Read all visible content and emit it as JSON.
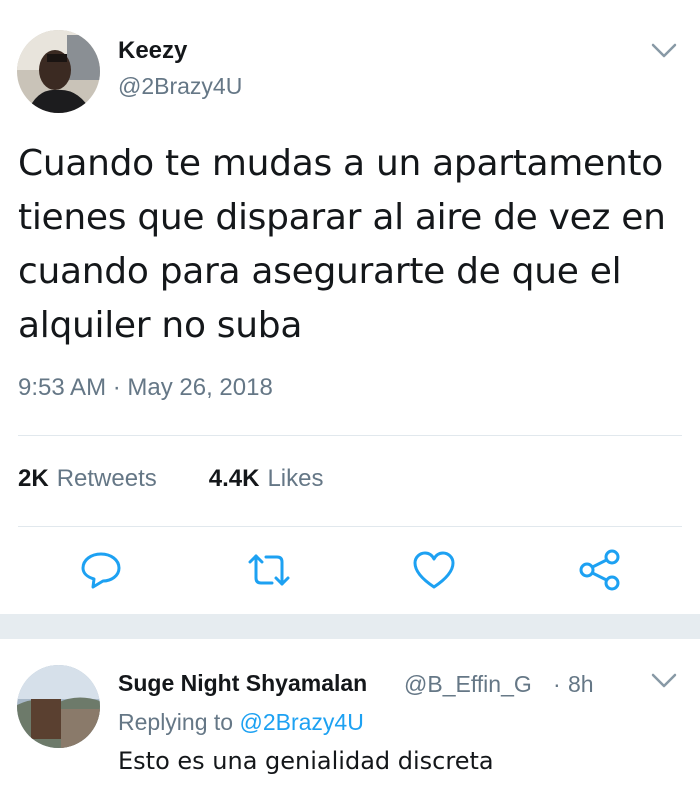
{
  "tweet": {
    "display_name": "Keezy",
    "handle": "@2Brazy4U",
    "text": "Cuando te mudas a un apartamento tienes que disparar al aire de vez en cuando para asegurarte de que el alquiler no suba",
    "timestamp": "9:53 AM · May 26, 2018",
    "retweets_count": "2K",
    "retweets_label": "Retweets",
    "likes_count": "4.4K",
    "likes_label": "Likes",
    "actions": [
      "reply-icon",
      "retweet-icon",
      "heart-icon",
      "share-icon"
    ],
    "menu_icon": "chevron-down-icon"
  },
  "reply": {
    "display_name": "Suge Night Shyamalan",
    "handle": "@B_Effin_G",
    "separator": "·",
    "time": "8h",
    "replying_prefix": "Replying to",
    "replying_to": "@2Brazy4U",
    "text": "Esto es una genialidad discreta",
    "menu_icon": "chevron-down-icon"
  },
  "colors": {
    "text": "#14171a",
    "secondary": "#657786",
    "link": "#1da1f2",
    "divider": "#e1e8ed",
    "gap": "#e6ecf0"
  }
}
